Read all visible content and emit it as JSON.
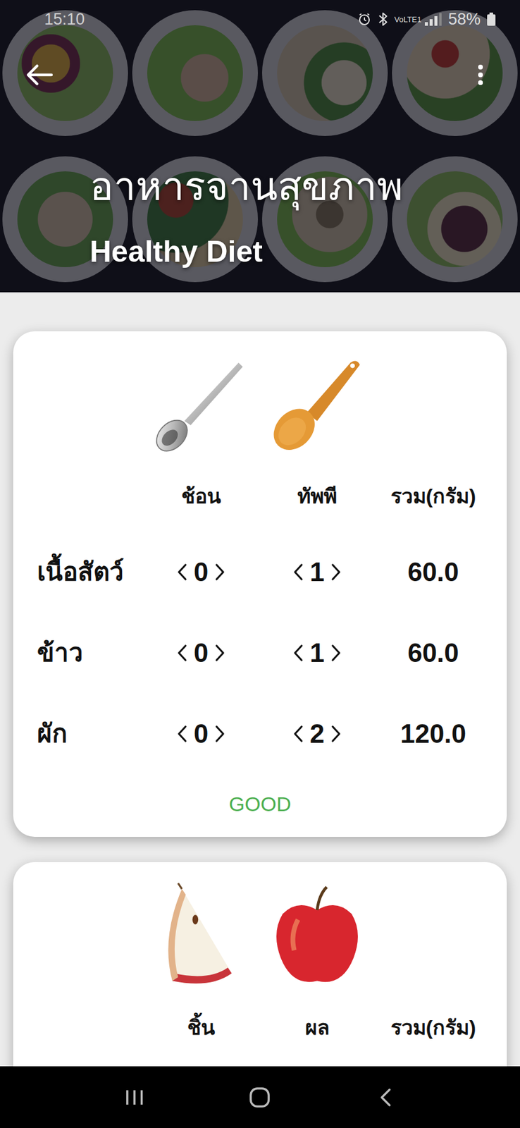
{
  "status_bar": {
    "time": "15:10",
    "network": "VoLTE1",
    "battery": "58%"
  },
  "header": {
    "title": "อาหารจานสุขภาพ",
    "subtitle": "Healthy Diet"
  },
  "portion_card": {
    "columns": [
      "ช้อน",
      "ทัพพี",
      "รวม(กรัม)"
    ],
    "rows": [
      {
        "label": "เนื้อสัตว์",
        "spoon": "0",
        "ladle": "1",
        "total": "60.0"
      },
      {
        "label": "ข้าว",
        "spoon": "0",
        "ladle": "1",
        "total": "60.0"
      },
      {
        "label": "ผัก",
        "spoon": "0",
        "ladle": "2",
        "total": "120.0"
      }
    ],
    "verdict": "GOOD"
  },
  "fruit_card": {
    "columns": [
      "ชิ้น",
      "ผล",
      "รวม(กรัม)"
    ]
  }
}
